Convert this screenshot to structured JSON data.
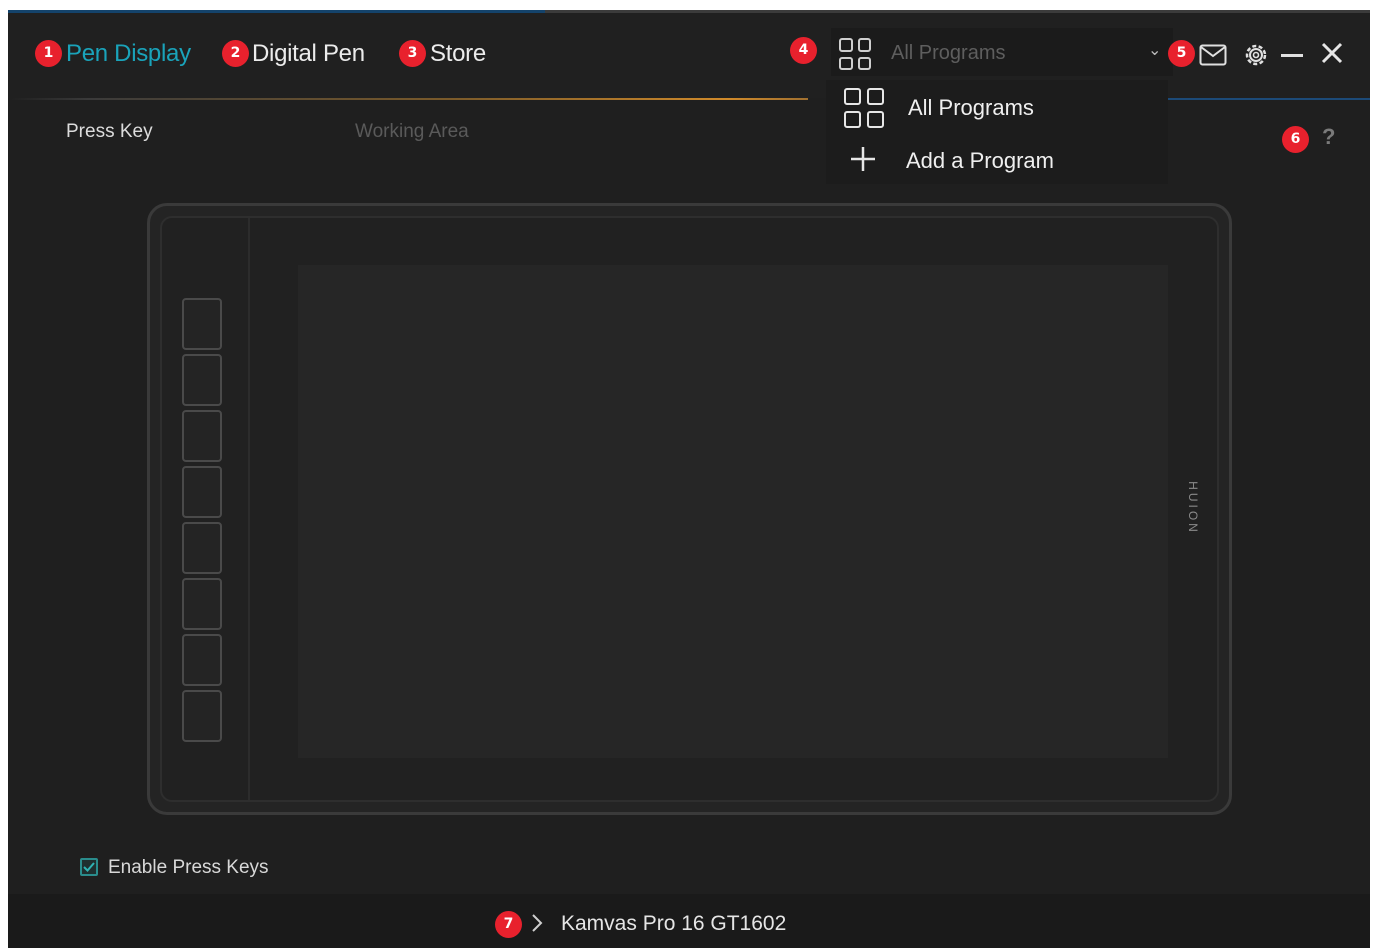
{
  "tabs": [
    {
      "badge": "1",
      "label": "Pen Display",
      "active": true
    },
    {
      "badge": "2",
      "label": "Digital Pen",
      "active": false
    },
    {
      "badge": "3",
      "label": "Store",
      "active": false
    }
  ],
  "program_select": {
    "badge": "4",
    "value": "All Programs"
  },
  "dropdown": {
    "items": [
      {
        "icon": "grid-icon",
        "label": "All Programs"
      },
      {
        "icon": "plus-icon",
        "label": "Add a Program"
      }
    ]
  },
  "toolbar": {
    "badge": "5",
    "mail_icon": "mail-icon",
    "settings_icon": "gear-icon",
    "minimize_icon": "minimize-icon",
    "close_icon": "close-icon"
  },
  "subtabs": {
    "press_key": "Press Key",
    "working_area": "Working Area"
  },
  "help": {
    "badge": "6",
    "label": "?"
  },
  "tablet": {
    "brand": "HUION",
    "press_keys": 8
  },
  "enable_press_keys": {
    "label": "Enable Press Keys",
    "checked": true
  },
  "device": {
    "badge": "7",
    "name": "Kamvas Pro 16 GT1602"
  },
  "colors": {
    "accent": "#1aa3ba",
    "badge": "#e8212d",
    "background": "#1f1f1f"
  }
}
